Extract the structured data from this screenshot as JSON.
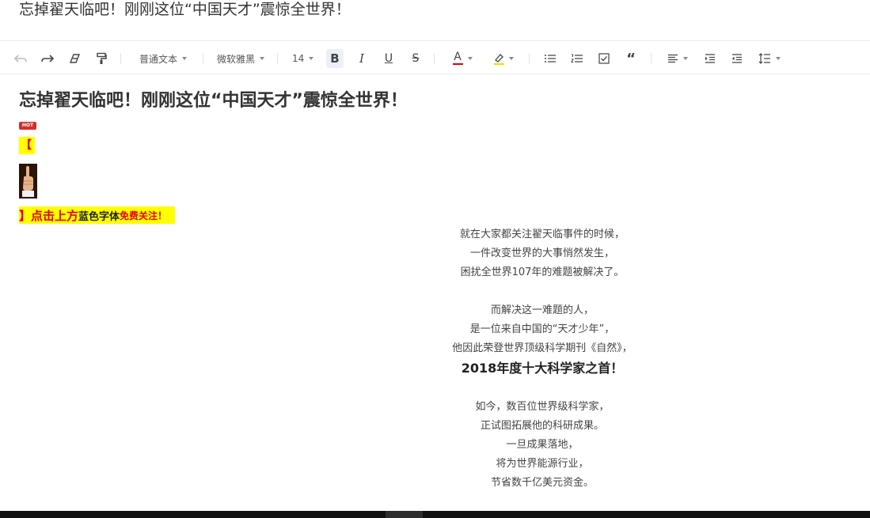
{
  "document": {
    "title": "忘掉翟天临吧！刚刚这位“中国天才”震惊全世界！"
  },
  "toolbar": {
    "paragraph_style": "普通文本",
    "font_family": "微软雅黑",
    "font_size": "14",
    "bold_label": "B",
    "italic_label": "I",
    "underline_label": "U",
    "strike_label": "S",
    "font_color_label": "A",
    "quote_label": "“",
    "font_color": "#e60000",
    "highlight_color": "#ffd800"
  },
  "article": {
    "heading": "忘掉翟天临吧！刚刚这位“中国天才”震惊全世界！",
    "hot_badge": "HOT",
    "bracket_open": "【",
    "follow": {
      "part1": "】点击上方",
      "part2": "蓝色字体",
      "part3": "免费关注！"
    },
    "paragraphs": [
      [
        "就在大家都关注翟天临事件的时候，",
        "一件改变世界的大事悄然发生，",
        "困扰全世界107年的难题被解决了。"
      ],
      [
        "而解决这一难题的人，",
        "是一位来自中国的“天才少年”，",
        "他因此荣登世界顶级科学期刊《自然》，"
      ],
      [
        "如今，数百位世界级科学家，",
        "正试图拓展他的科研成果。",
        "一旦成果落地，",
        "将为世界能源行业，",
        "节省数千亿美元资金。"
      ]
    ],
    "highlight_line": "2018年度十大科学家之首！"
  }
}
